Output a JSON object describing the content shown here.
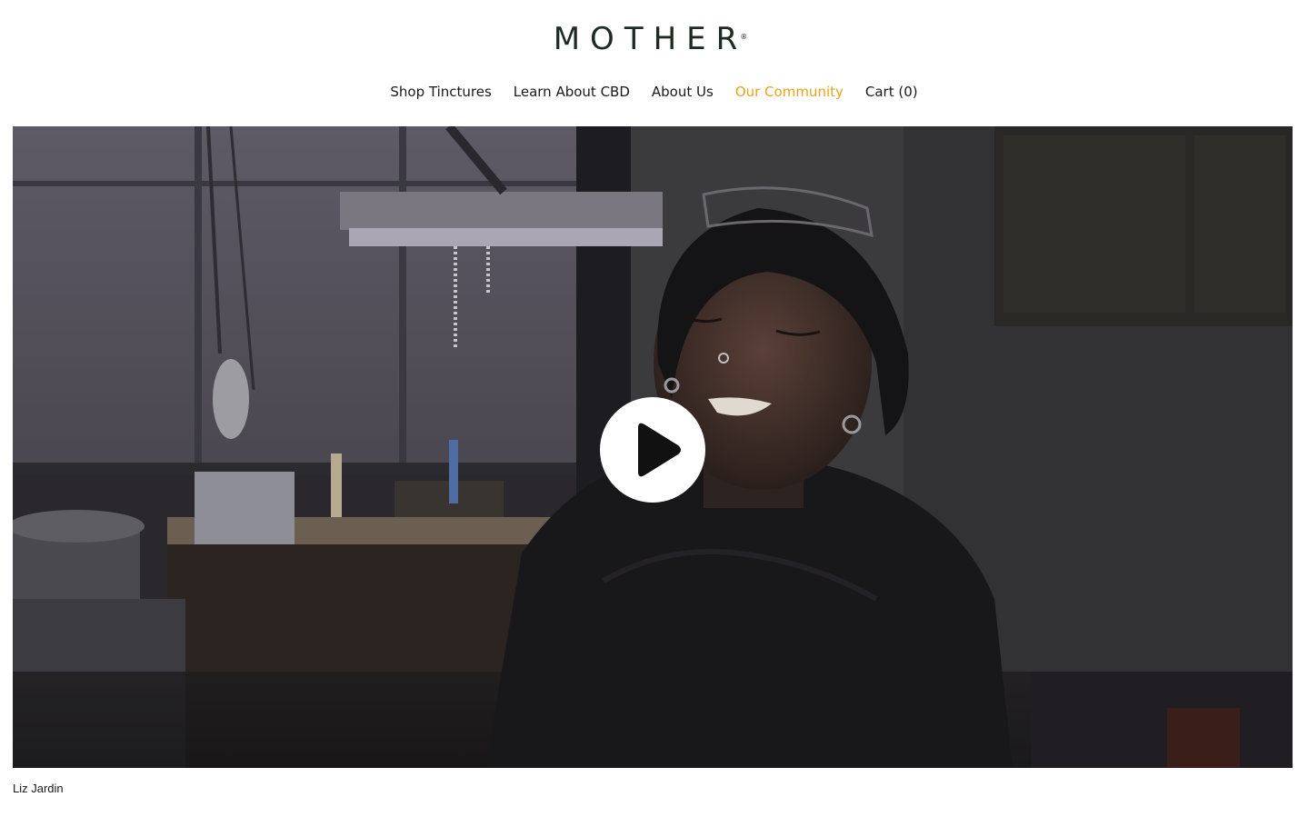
{
  "brand": {
    "logo_text": "MOTHER",
    "registered_mark": "®",
    "logo_color": "#1d2b22"
  },
  "nav": {
    "items": [
      {
        "label": "Shop Tinctures",
        "active": false
      },
      {
        "label": "Learn About CBD",
        "active": false
      },
      {
        "label": "About Us",
        "active": false
      },
      {
        "label": "Our Community",
        "active": true
      },
      {
        "label": "Cart (0)",
        "active": false
      }
    ],
    "active_color": "#e8a21c"
  },
  "video": {
    "play_icon": "play-icon",
    "caption": "Liz Jardin"
  }
}
